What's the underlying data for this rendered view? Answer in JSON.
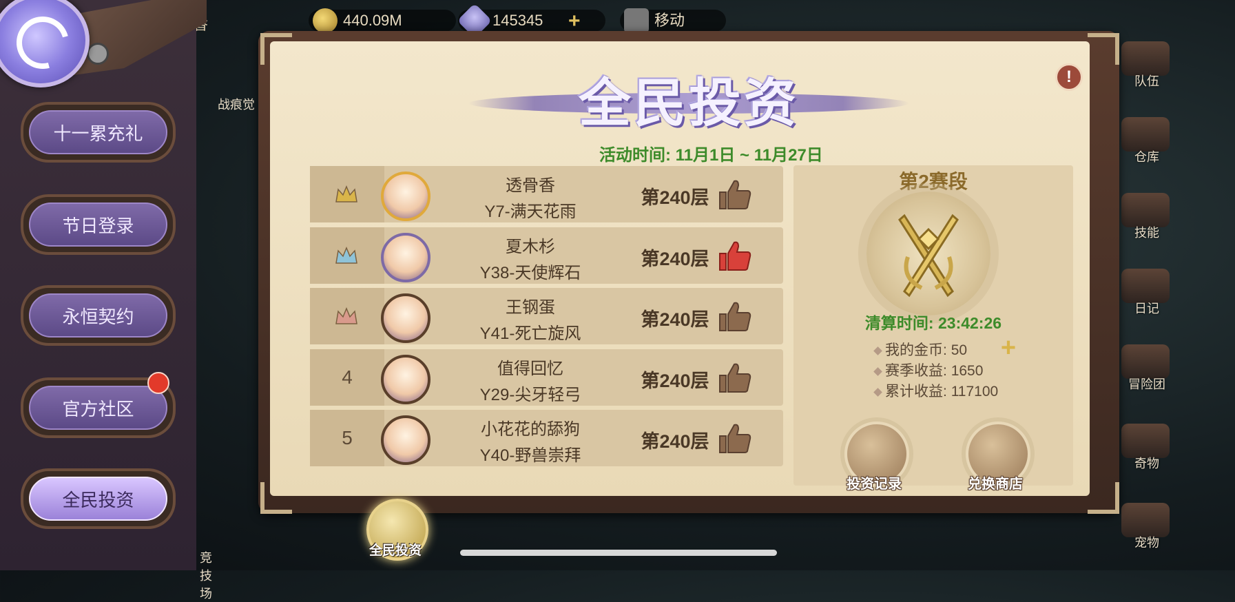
{
  "top_bar": {
    "left_text": "香",
    "gold": "440.09M",
    "gems": "145345",
    "move_label": "移动"
  },
  "sidebar": {
    "items": [
      {
        "label": "十一累充礼",
        "active": false
      },
      {
        "label": "节日登录",
        "active": false
      },
      {
        "label": "永恒契约",
        "active": false
      },
      {
        "label": "官方社区",
        "active": false,
        "has_notification": true
      },
      {
        "label": "全民投资",
        "active": true
      }
    ]
  },
  "background_left": {
    "upper_label": "战痕觉",
    "lower_label": "竞技场"
  },
  "right_menu": [
    {
      "label": "队伍"
    },
    {
      "label": "仓库"
    },
    {
      "label": "技能"
    },
    {
      "label": "日记"
    },
    {
      "label": "冒险团"
    },
    {
      "label": "奇物"
    },
    {
      "label": "宠物"
    }
  ],
  "panel": {
    "title": "全民投资",
    "event_time_label": "活动时间:",
    "event_time_value": "11月1日 ~ 11月27日",
    "ranking": [
      {
        "rank": "1",
        "crown": "gold",
        "name": "透骨香",
        "team": "Y7-满天花雨",
        "floor": "第240层",
        "liked": false
      },
      {
        "rank": "2",
        "crown": "silver",
        "name": "夏木杉",
        "team": "Y38-天使辉石",
        "floor": "第240层",
        "liked": true
      },
      {
        "rank": "3",
        "crown": "bronze",
        "name": "王钢蛋",
        "team": "Y41-死亡旋风",
        "floor": "第240层",
        "liked": false
      },
      {
        "rank": "4",
        "crown": null,
        "name": "值得回忆",
        "team": "Y29-尖牙轻弓",
        "floor": "第240层",
        "liked": false
      },
      {
        "rank": "5",
        "crown": null,
        "name": "小花花的舔狗",
        "team": "Y40-野兽崇拜",
        "floor": "第240层",
        "liked": false
      }
    ],
    "stage": {
      "title": "第2赛段",
      "settle_time_label": "清算时间:",
      "settle_time_value": "23:42:26",
      "stats": [
        {
          "label": "我的金币:",
          "value": "50"
        },
        {
          "label": "赛季收益:",
          "value": "1650"
        },
        {
          "label": "累计收益:",
          "value": "117100"
        }
      ],
      "records_label": "投资记录",
      "shop_label": "兑换商店"
    }
  },
  "bottom_tab": {
    "label": "全民投资"
  },
  "colors": {
    "accent_green": "#3d8b2a",
    "like_red": "#d8413a",
    "like_inactive": "#8c6a4e",
    "notification": "#e23a2a",
    "active_tab": "#c9b4f5"
  }
}
